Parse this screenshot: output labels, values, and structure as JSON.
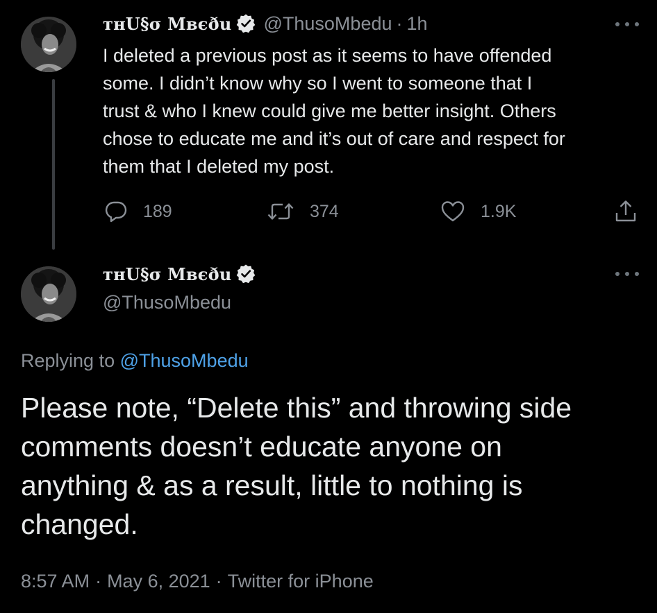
{
  "tweets": [
    {
      "author": {
        "display_name": "ᴛʜU§σ Mвєðu",
        "handle": "@ThusoMbedu",
        "verified": true
      },
      "time_ago": "1h",
      "separator": "·",
      "text_lines": [
        "I deleted a previous post as it seems to have offended",
        "some. I didn’t know why so I went to someone that I",
        "trust & who I knew could give me better insight. Others",
        "chose to educate me and it’s out of care and respect for",
        "them that I deleted my post."
      ],
      "stats": {
        "replies": "189",
        "retweets": "374",
        "likes": "1.9K"
      }
    },
    {
      "author": {
        "display_name": "ᴛʜU§σ Mвєðu",
        "handle": "@ThusoMbedu",
        "verified": true
      },
      "replying_to_label": "Replying to",
      "replying_to_handle": "@ThusoMbedu",
      "text_lines": [
        "Please note, “Delete this” and throwing side",
        "comments doesn’t educate anyone on",
        "anything & as a result, little to nothing is",
        "changed."
      ],
      "timestamp": {
        "time": "8:57 AM",
        "date": "May 6, 2021",
        "source": "Twitter for iPhone",
        "separator": "·"
      }
    }
  ],
  "icons": {
    "reply": "reply-icon",
    "retweet": "retweet-icon",
    "like": "heart-icon",
    "share": "share-icon",
    "verified": "verified-badge-icon",
    "more": "more-options-icon"
  },
  "colors": {
    "background": "#000000",
    "text": "#e7e9ea",
    "secondary": "#8b9097",
    "link": "#4ea2e8",
    "thread_line": "#3a3d41"
  }
}
